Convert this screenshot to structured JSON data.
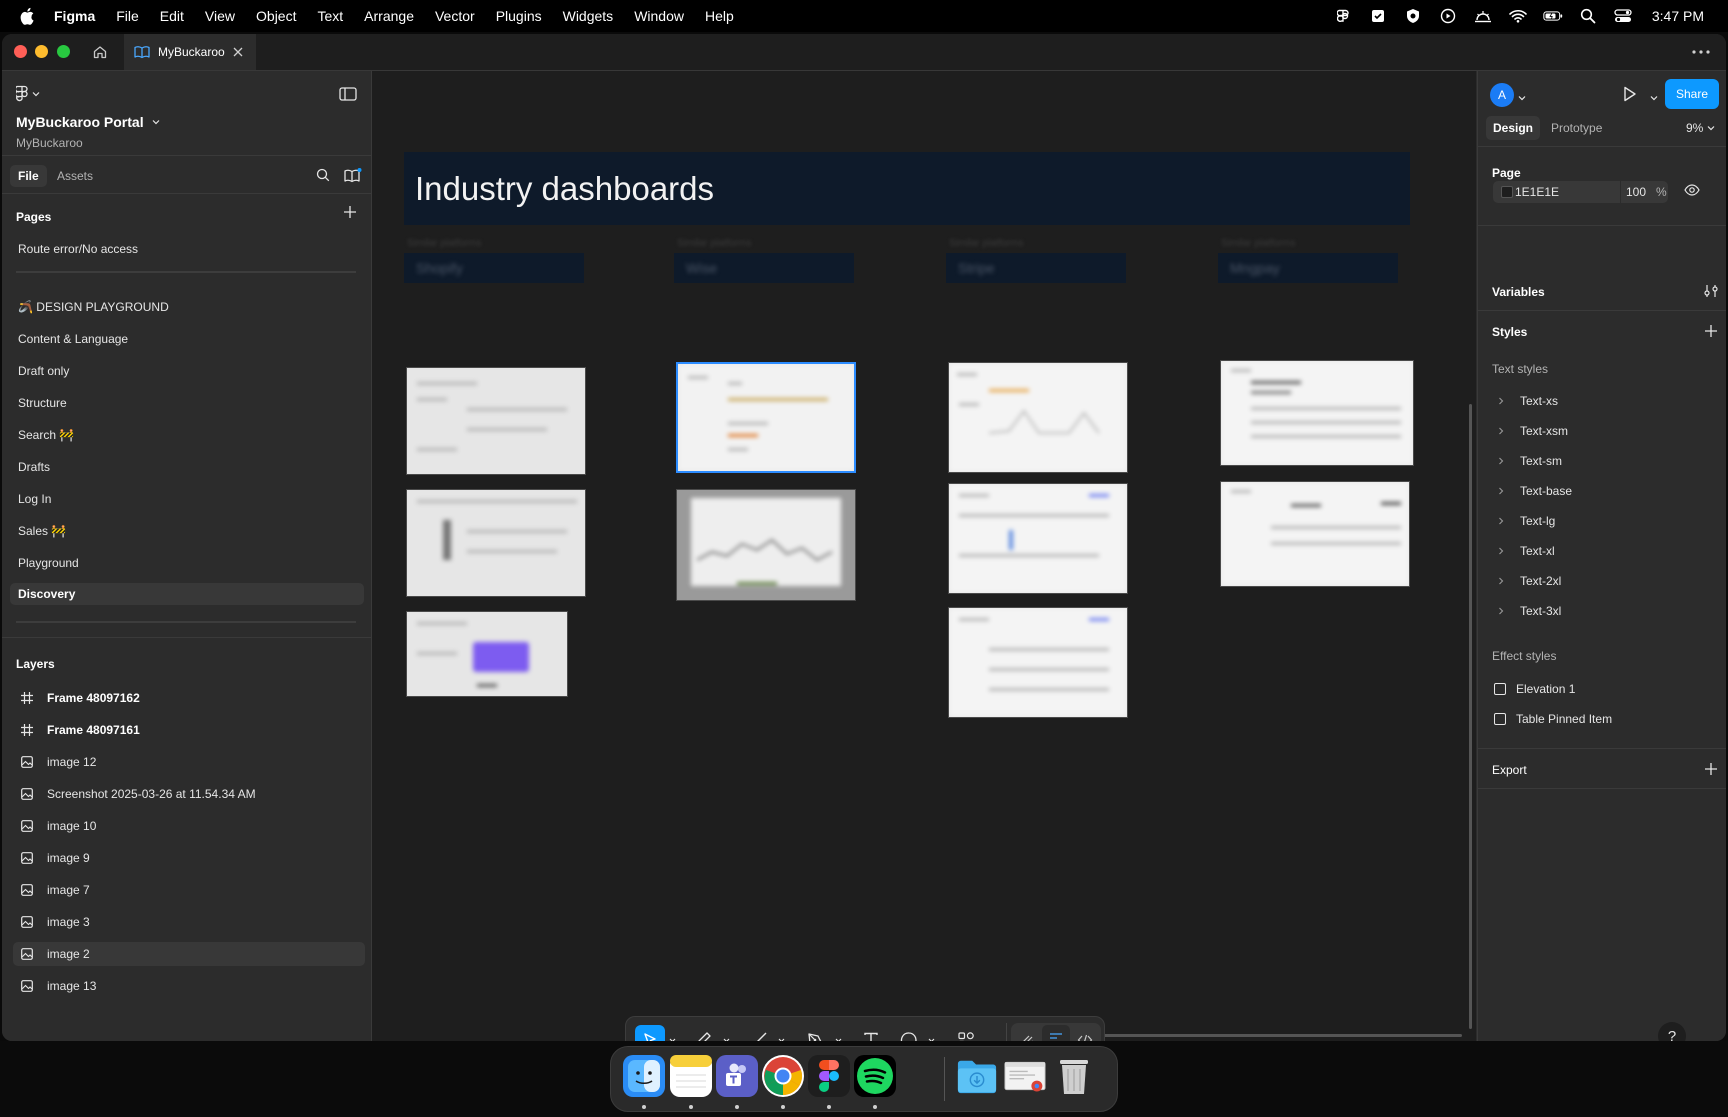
{
  "menubar": {
    "app_name": "Figma",
    "menus": [
      "File",
      "Edit",
      "View",
      "Object",
      "Text",
      "Arrange",
      "Vector",
      "Plugins",
      "Widgets",
      "Window",
      "Help"
    ],
    "clock": "3:47 PM"
  },
  "window": {
    "tab_title": "MyBuckaroo"
  },
  "left_panel": {
    "project_title": "MyBuckaroo Portal",
    "team_name": "MyBuckaroo",
    "tab_file": "File",
    "tab_assets": "Assets",
    "pages_header": "Pages",
    "pages": [
      "Route error/No access",
      "🪃 DESIGN PLAYGROUND",
      "Content & Language",
      "Draft only",
      "Structure",
      "Search 🚧",
      "Drafts",
      "Log In",
      "Sales 🚧",
      "Playground",
      "Discovery"
    ],
    "active_page": "Discovery",
    "layers_header": "Layers",
    "layers": [
      {
        "name": "Frame 48097162",
        "type": "frame"
      },
      {
        "name": "Frame 48097161",
        "type": "frame"
      },
      {
        "name": "image 12",
        "type": "image"
      },
      {
        "name": "Screenshot 2025-03-26 at 11.54.34 AM",
        "type": "image"
      },
      {
        "name": "image 10",
        "type": "image"
      },
      {
        "name": "image 9",
        "type": "image"
      },
      {
        "name": "image 7",
        "type": "image"
      },
      {
        "name": "image 3",
        "type": "image"
      },
      {
        "name": "image 2",
        "type": "image",
        "selected": true
      },
      {
        "name": "image 13",
        "type": "image"
      }
    ]
  },
  "canvas": {
    "title": "Industry dashboards",
    "columns": [
      {
        "caption": "Similar platforms",
        "platform": "Shopify"
      },
      {
        "caption": "Similar platforms",
        "platform": "Wise"
      },
      {
        "caption": "Similar platforms",
        "platform": "Stripe"
      },
      {
        "caption": "Similar platforms",
        "platform": "Mngpay"
      }
    ]
  },
  "toolbar": {
    "tools": [
      "move-tool",
      "frame-tool",
      "shape-tool",
      "pen-tool",
      "text-tool",
      "comment-tool",
      "actions-tool",
      "draw-mode",
      "design-mode",
      "dev-mode"
    ]
  },
  "right_panel": {
    "avatar_initial": "A",
    "share_label": "Share",
    "tab_design": "Design",
    "tab_prototype": "Prototype",
    "zoom": "9%",
    "page_section": "Page",
    "page_color": "1E1E1E",
    "page_opacity": "100",
    "page_opacity_unit": "%",
    "variables_section": "Variables",
    "styles_section": "Styles",
    "text_styles_header": "Text styles",
    "text_styles": [
      "Text-xs",
      "Text-xsm",
      "Text-sm",
      "Text-base",
      "Text-lg",
      "Text-xl",
      "Text-2xl",
      "Text-3xl"
    ],
    "effect_styles_header": "Effect styles",
    "effect_styles": [
      "Elevation 1",
      "Table Pinned Item"
    ],
    "export_section": "Export",
    "help_label": "?"
  },
  "dock": {
    "apps": [
      "finder-icon",
      "notes-icon",
      "teams-icon",
      "chrome-icon",
      "figma-icon",
      "spotify-icon",
      "downloads-folder-icon",
      "chrome-window-icon",
      "trash-icon"
    ]
  }
}
